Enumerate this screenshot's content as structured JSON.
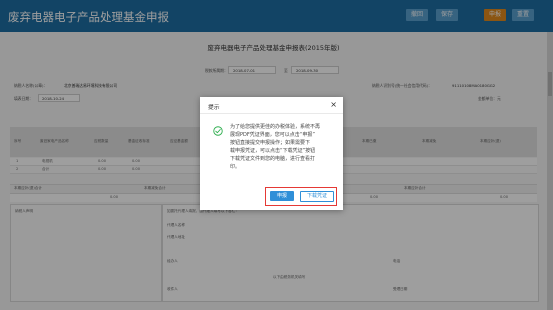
{
  "header": {
    "title": "废弃电器电子产品处理基金申报",
    "buttons": [
      "撤回",
      "保存",
      "申报",
      "重置"
    ]
  },
  "form": {
    "title": "废弃电器电子产品处理基金申报表(2015年版)",
    "period_label": "税款所属期：",
    "period_start": "2018-07-01",
    "period_to": "至",
    "period_end": "2018-09-30",
    "taxpayer_name_label": "纳税人名称(公章)：",
    "taxpayer_name": "北京普瑞达易环境科技有限公司",
    "taxpayer_id_label": "纳税人识别号(统一社会信用代码)：",
    "taxpayer_id": "91110108MA0180GG2",
    "fill_date_label": "填表日期：",
    "fill_date": "2018-10-24",
    "amount_unit_label": "金额单位：元",
    "table_headers": [
      "序号",
      "废旧家电产品名称",
      "应税数量",
      "基金征收标准",
      "应征基金额",
      "本期已缴",
      "本期减免",
      "本期应补(退)"
    ],
    "rows": [
      {
        "no": "1",
        "name": "电视机",
        "qty": "0.00",
        "rate": "0.00"
      },
      {
        "no": "2",
        "name": "合计",
        "qty": "0.00",
        "rate": "0.00"
      }
    ],
    "summary_labels": [
      "本期应补(退)合计",
      "本期减免合计",
      "本期已缴合计",
      "本期应补合计"
    ],
    "summary_values": [
      "0.00",
      "0.00",
      "0.00",
      "0.00"
    ],
    "declaration_title": "纳税人声明",
    "agent_label": "如委托代理人填报，由代理人填写以下各栏：",
    "agent_fields": [
      "代理人名称",
      "代理人地址",
      "经办人",
      "电话"
    ],
    "tax_org_label": "以下由税务机关填写",
    "receiver_label": "收件人",
    "received_date_label": "受理日期"
  },
  "modal": {
    "title": "提示",
    "close_symbol": "×",
    "message": "为了给您提供更佳的办税体验，系统不再\n展现PDF凭证界面，您可以点击“申报”\n按钮直接提交申报操作；如果需要下\n载申报凭证，可以点击“下载凭证”按钮\n下载凭证文件到您的电脑，进行查看打\n印。",
    "primary_button": "申报",
    "secondary_button": "下载凭证",
    "accent_color": "#2f8fd8",
    "highlight_color": "#e53935"
  }
}
